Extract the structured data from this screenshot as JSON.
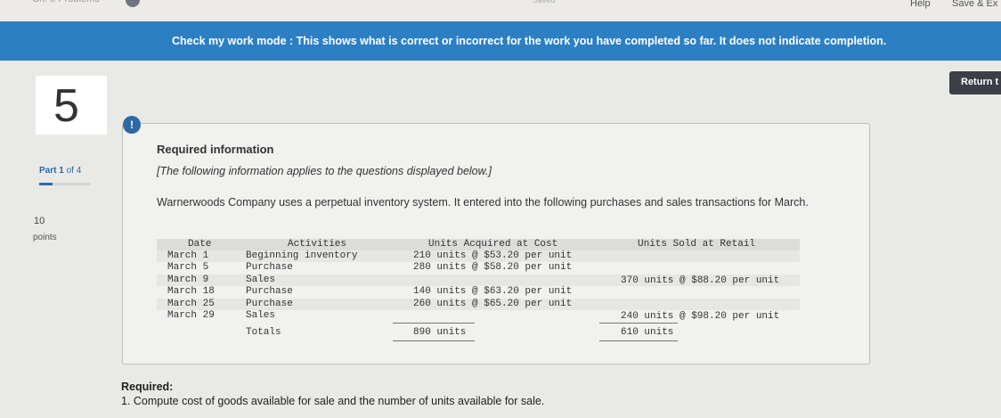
{
  "header": {
    "help_label": "Help",
    "save_exit_label": "Save & Ex"
  },
  "banner": {
    "text": "Check my work mode : This shows what is correct or incorrect for the work you have completed so far. It does not indicate completion."
  },
  "return_button": {
    "label": "Return t"
  },
  "question": {
    "number": "5",
    "part_label": "Part 1 of 4",
    "part_prefix": "Part 1",
    "part_suffix": " of 4",
    "part_progress": 0.25,
    "points_value": "10",
    "points_label": "points"
  },
  "info": {
    "alert_icon": "!",
    "title": "Required information",
    "note": "[The following information applies to the questions displayed below.]",
    "paragraph": "Warnerwoods Company uses a perpetual inventory system. It entered into the following purchases and sales transactions for March."
  },
  "table": {
    "headers": [
      "Date",
      "Activities",
      "Units Acquired at Cost",
      "Units Sold at Retail"
    ],
    "rows": [
      {
        "date": "March 1",
        "activity": "Beginning inventory",
        "acquired": "210 units  @ $53.20 per unit",
        "sold": ""
      },
      {
        "date": "March 5",
        "activity": "Purchase",
        "acquired": "280 units  @ $58.20 per unit",
        "sold": ""
      },
      {
        "date": "March 9",
        "activity": "Sales",
        "acquired": "",
        "sold": "370 units @ $88.20 per unit"
      },
      {
        "date": "March 18",
        "activity": "Purchase",
        "acquired": "140 units  @ $63.20 per unit",
        "sold": ""
      },
      {
        "date": "March 25",
        "activity": "Purchase",
        "acquired": "260 units  @ $65.20 per unit",
        "sold": ""
      },
      {
        "date": "March 29",
        "activity": "Sales",
        "acquired": "",
        "sold": "240 units @ $98.20 per unit"
      }
    ],
    "totals_label": "Totals",
    "total_acquired": "890 units",
    "total_sold": "610 units"
  },
  "required": {
    "label": "Required:",
    "item": "1. Compute cost of goods available for sale and the number of units available for sale."
  }
}
